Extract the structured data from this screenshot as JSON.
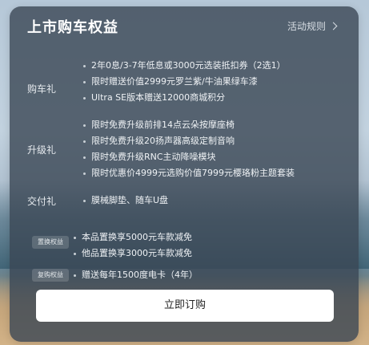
{
  "header": {
    "title": "上市购车权益",
    "rules_label": "活动规则"
  },
  "sections": [
    {
      "label": "购车礼",
      "items": [
        "2年0息/3-7年低息或3000元选装抵扣券（2选1）",
        "限时赠送价值2999元罗兰紫/牛油果绿车漆",
        "Ultra SE版本赠送12000商城积分"
      ]
    },
    {
      "label": "升级礼",
      "items": [
        "限时免费升级前排14点云朵按摩座椅",
        "限时免费升级20扬声器高级定制音响",
        "限时免费升级RNC主动降噪模块",
        "限时优惠价4999元选购价值7999元樱珞粉主题套装"
      ]
    },
    {
      "label": "交付礼",
      "items": [
        "膜械脚垫、随车U盘"
      ]
    }
  ],
  "benefits": [
    {
      "badge": "置换权益",
      "items": [
        "本品置换享5000元车款减免",
        "他品置换享3000元车款减免"
      ]
    },
    {
      "badge": "复购权益",
      "items": [
        "赠送每年1500度电卡（4年）"
      ]
    }
  ],
  "cta_label": "立即订购"
}
